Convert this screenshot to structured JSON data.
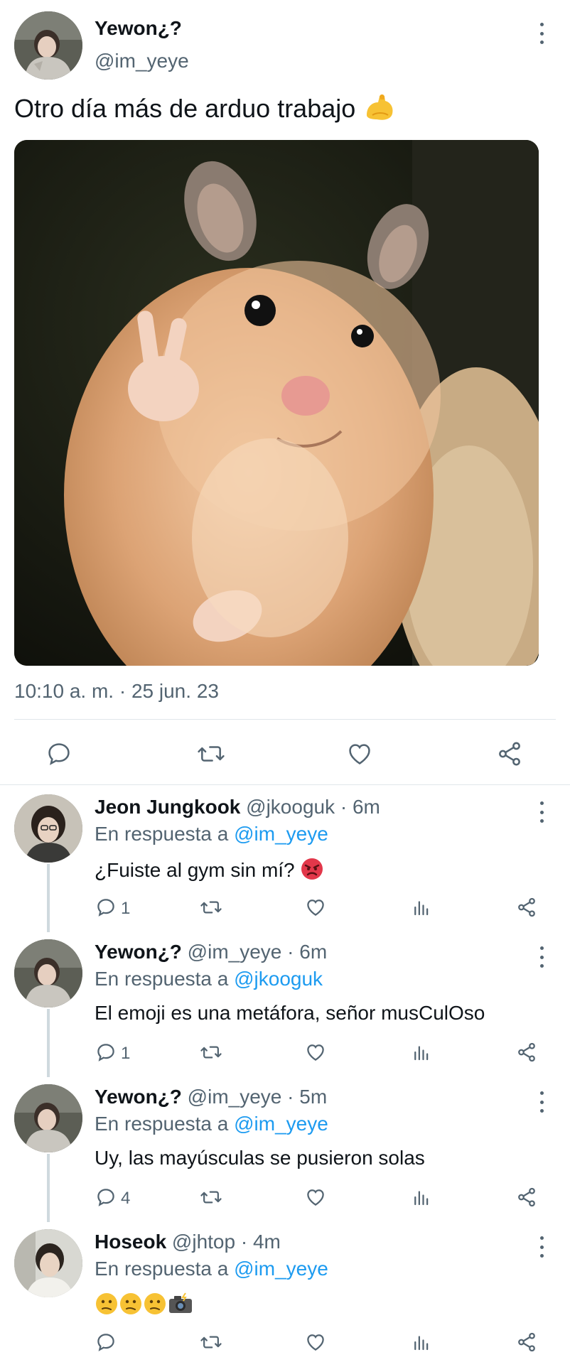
{
  "main_tweet": {
    "name": "Yewon¿?",
    "handle": "@im_yeye",
    "text": "Otro día más de arduo trabajo",
    "text_emoji": "flexed-biceps-emoji",
    "timestamp": "10:10 a. m. · 25 jun. 23",
    "media": "hamster-peace-sign-photo",
    "actions": [
      "reply-icon",
      "retweet-icon",
      "like-icon",
      "share-icon"
    ]
  },
  "replies": [
    {
      "name": "Jeon Jungkook",
      "meta": " @jkooguk · 6m",
      "reply_prefix": "En respuesta a ",
      "reply_to": "@im_yeye",
      "text": "¿Fuiste al gym sin mí?",
      "emoji": "angry-face-emoji",
      "reply_count": "1"
    },
    {
      "name": "Yewon¿?",
      "meta": " @im_yeye · 6m",
      "reply_prefix": "En respuesta a ",
      "reply_to": "@jkooguk",
      "text": "El emoji es una metáfora, señor musCulOso",
      "emoji": "",
      "reply_count": "1"
    },
    {
      "name": "Yewon¿?",
      "meta": " @im_yeye · 5m",
      "reply_prefix": "En respuesta a ",
      "reply_to": "@im_yeye",
      "text": "Uy, las mayúsculas se pusieron solas",
      "emoji": "",
      "reply_count": "4"
    },
    {
      "name": "Hoseok",
      "meta": " @jhtop · 4m",
      "reply_prefix": "En respuesta a ",
      "reply_to": "@im_yeye",
      "text": "",
      "emoji": "confused-face-emoji x3, camera-flash-emoji",
      "reply_count": ""
    }
  ],
  "colors": {
    "text": "#0f1419",
    "secondary": "#536471",
    "link": "#1d9bf0",
    "divider": "#e1e6ea",
    "thread_line": "#cfd9de"
  }
}
